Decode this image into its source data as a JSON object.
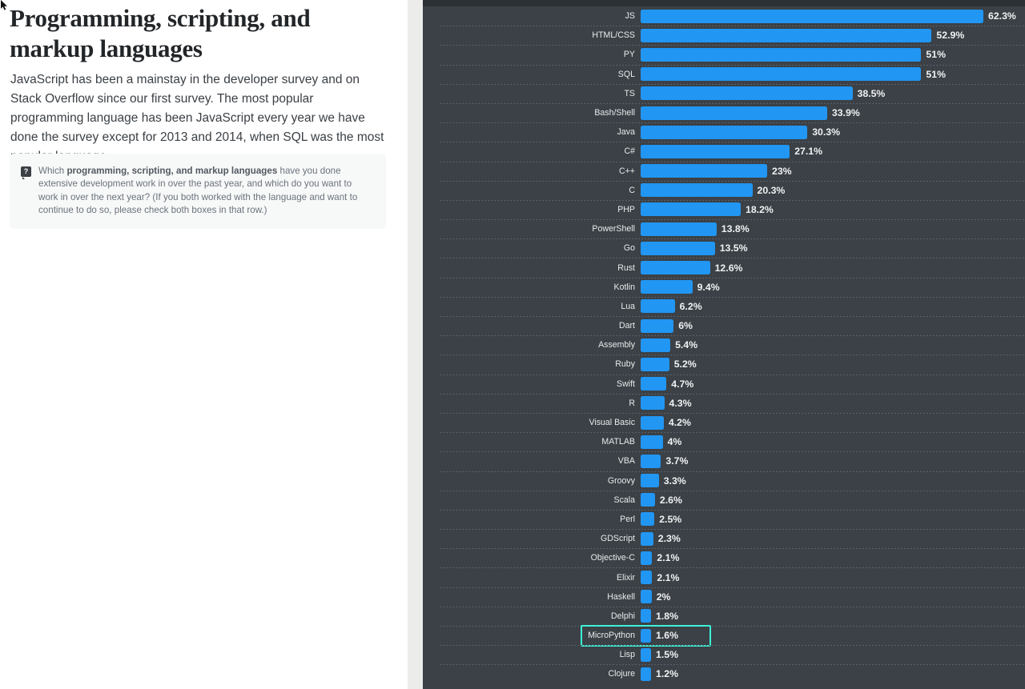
{
  "left": {
    "title": "Programming, scripting, and markup languages",
    "paragraph": "JavaScript has been a mainstay in the developer survey and on Stack Overflow since our first survey. The most popular programming language has been JavaScript every year we have done the survey except for 2013 and 2014, when SQL was the most popular language.",
    "question_icon": "?",
    "question_prefix": "Which ",
    "question_bold": "programming, scripting, and markup languages",
    "question_suffix": " have you done extensive development work in over the past year, and which do you want to work in over the next year? (If you both worked with the language and want to continue to do so, please check both boxes in that row.)"
  },
  "colors": {
    "bar": "#2196f3",
    "chart_background": "#3b4146",
    "chart_topbar": "#2c3136",
    "highlight_outline": "#3df2d8",
    "gutter": "#ececeb",
    "label_text": "#e8eaec",
    "value_text": "#f0f2f3"
  },
  "chart_data": {
    "type": "bar",
    "orientation": "horizontal",
    "title": "Programming, scripting, and markup languages",
    "xlabel": "",
    "ylabel": "",
    "grid": true,
    "legend": null,
    "xlim": [
      0,
      62.3
    ],
    "units": "%",
    "highlighted_category": "MicroPython",
    "categories": [
      "JS",
      "HTML/CSS",
      "PY",
      "SQL",
      "TS",
      "Bash/Shell",
      "Java",
      "C#",
      "C++",
      "C",
      "PHP",
      "PowerShell",
      "Go",
      "Rust",
      "Kotlin",
      "Lua",
      "Dart",
      "Assembly",
      "Ruby",
      "Swift",
      "R",
      "Visual Basic",
      "MATLAB",
      "VBA",
      "Groovy",
      "Scala",
      "Perl",
      "GDScript",
      "Objective-C",
      "Elixir",
      "Haskell",
      "Delphi",
      "MicroPython",
      "Lisp",
      "Clojure"
    ],
    "values": [
      62.3,
      52.9,
      51,
      51,
      38.5,
      33.9,
      30.3,
      27.1,
      23,
      20.3,
      18.2,
      13.8,
      13.5,
      12.6,
      9.4,
      6.2,
      6,
      5.4,
      5.2,
      4.7,
      4.3,
      4.2,
      4,
      3.7,
      3.3,
      2.6,
      2.5,
      2.3,
      2.1,
      2.1,
      2,
      1.8,
      1.6,
      1.5,
      1.2
    ],
    "value_labels": [
      "62.3%",
      "52.9%",
      "51%",
      "51%",
      "38.5%",
      "33.9%",
      "30.3%",
      "27.1%",
      "23%",
      "20.3%",
      "18.2%",
      "13.8%",
      "13.5%",
      "12.6%",
      "9.4%",
      "6.2%",
      "6%",
      "5.4%",
      "5.2%",
      "4.7%",
      "4.3%",
      "4.2%",
      "4%",
      "3.7%",
      "3.3%",
      "2.6%",
      "2.5%",
      "2.3%",
      "2.1%",
      "2.1%",
      "2%",
      "1.8%",
      "1.6%",
      "1.5%",
      "1.2%"
    ]
  }
}
